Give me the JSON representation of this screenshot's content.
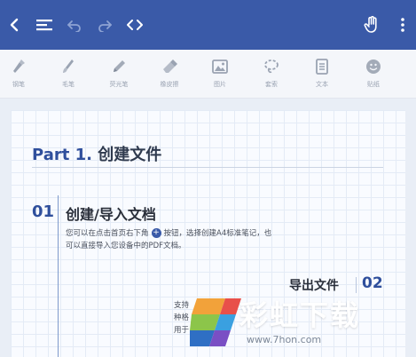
{
  "colors": {
    "topbar": "#3a5aa8",
    "accent": "#2f4f9c"
  },
  "topbar": {
    "icons": [
      "back-icon",
      "toc-menu-icon",
      "undo-icon",
      "redo-icon",
      "code-icon",
      "hand-icon",
      "more-vertical-icon"
    ]
  },
  "toolbar": {
    "tools": [
      {
        "label": "钢笔",
        "icon": "fountain-pen-icon"
      },
      {
        "label": "毛笔",
        "icon": "brush-icon"
      },
      {
        "label": "荧光笔",
        "icon": "highlighter-icon"
      },
      {
        "label": "橡皮擦",
        "icon": "eraser-icon"
      },
      {
        "label": "图片",
        "icon": "image-icon"
      },
      {
        "label": "套索",
        "icon": "lasso-icon"
      },
      {
        "label": "文本",
        "icon": "text-icon"
      },
      {
        "label": "贴纸",
        "icon": "sticker-icon"
      }
    ]
  },
  "document": {
    "part_prefix": "Part 1.",
    "part_title": "创建文件",
    "section1": {
      "number": "01",
      "title": "创建/导入文档",
      "text_before_icon": "您可以在点击首页右下角",
      "text_after_icon": "按钮，选择创建A4标准笔记，也可以直接导入您设备中的PDF文档。"
    },
    "section2": {
      "number": "02",
      "title": "导出文件",
      "lines": [
        "支持",
        "种格",
        "用于"
      ]
    }
  },
  "watermark": {
    "brand": "彩虹下载",
    "url": "www.7hon.com"
  }
}
